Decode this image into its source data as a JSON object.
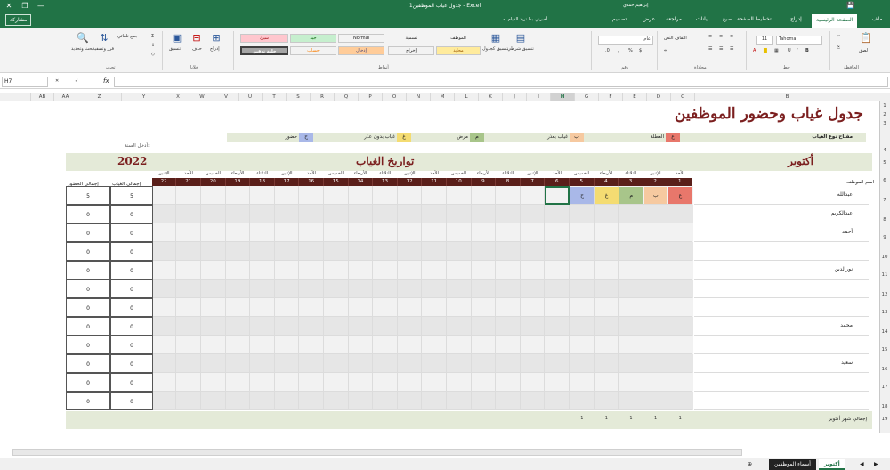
{
  "window": {
    "title": "جدول غياب الموظفين1 - Excel",
    "user": "إبراهيم حمدي",
    "minimize": "—",
    "maximize": "❐",
    "close": "✕",
    "save_icon": "save-icon"
  },
  "tabs": [
    {
      "label": "ملف"
    },
    {
      "label": "الصفحة الرئيسية",
      "active": true
    },
    {
      "label": "إدراج"
    },
    {
      "label": "تخطيط الصفحة"
    },
    {
      "label": "صيغ"
    },
    {
      "label": "بيانات"
    },
    {
      "label": "مراجعة"
    },
    {
      "label": "عرض"
    },
    {
      "label": "تصميم"
    }
  ],
  "tell_me": "أخبرني بما تريد القيام به",
  "share": "مشاركة",
  "ribbon": {
    "groups": [
      "الحافظة",
      "خط",
      "محاذاة",
      "رقم",
      "أنماط",
      "خلايا",
      "تحرير"
    ],
    "font_name": "Tahoma",
    "font_size": "11",
    "number_format": "عام",
    "styles": [
      {
        "label": "Normal",
        "bg": "#ffffff",
        "fg": "#000000"
      },
      {
        "label": "جيد",
        "bg": "#c6efce",
        "fg": "#006100"
      },
      {
        "label": "سيئ",
        "bg": "#ffc7ce",
        "fg": "#9c0006"
      },
      {
        "label": "محايد",
        "bg": "#ffeb9c",
        "fg": "#9c5700"
      },
      {
        "label": "إدخال",
        "bg": "#ffcc99",
        "fg": "#3f3f76"
      },
      {
        "label": "حساب",
        "bg": "#f2f2f2",
        "fg": "#fa7d00"
      },
      {
        "label": "خلية تدقيق",
        "bg": "#a5a5a5",
        "fg": "#ffffff"
      },
      {
        "label": "الموظف",
        "bg": "#ffffff",
        "fg": "#000000"
      },
      {
        "label": "تسمية",
        "bg": "#ffffff",
        "fg": "#000000"
      },
      {
        "label": "إخراج",
        "bg": "#f2f2f2",
        "fg": "#3f3f3f"
      }
    ],
    "buttons": {
      "paste": "لصق",
      "insert": "إدراج",
      "delete": "حذف",
      "format": "تنسيق",
      "sort": "فرز وتصفية",
      "find": "بحث وتحديد",
      "conditional": "تنسيق شرطي",
      "as_table": "تنسيق كجدول",
      "wrap": "التفاف النص",
      "autosum": "جمع تلقائي"
    }
  },
  "formula_bar": {
    "name_box": "H7",
    "fx": "fx",
    "value": ""
  },
  "columns": [
    "B",
    "C",
    "D",
    "E",
    "F",
    "G",
    "H",
    "I",
    "J",
    "K",
    "L",
    "M",
    "N",
    "O",
    "P",
    "Q",
    "R",
    "S",
    "T",
    "U",
    "V",
    "W",
    "X",
    "Y",
    "Z",
    "AA",
    "AB"
  ],
  "selected_column": "H",
  "rows": [
    "1",
    "2",
    "3",
    "4",
    "5",
    "6",
    "7",
    "8",
    "9",
    "10",
    "11",
    "12",
    "13",
    "14",
    "15",
    "16",
    "17",
    "18",
    "19"
  ],
  "sheet": {
    "title": "جدول غياب وحضور الموظفين",
    "legend_heading": "مفتاح نوع الغياب",
    "legend": [
      {
        "code": "ع",
        "label": "العطلة",
        "color": "#e8776b"
      },
      {
        "code": "ب",
        "label": "غياب بعذر",
        "color": "#f6c9a0"
      },
      {
        "code": "م",
        "label": "مرض",
        "color": "#a8c58a"
      },
      {
        "code": "غ",
        "label": "غياب بدون عذر",
        "color": "#f4dc72"
      },
      {
        "code": "ح",
        "label": "حضور",
        "color": "#a9b8e8"
      }
    ],
    "month": "أكتوبر",
    "dates_heading": "تواريخ الغياب",
    "year": "2022",
    "year_label": "أدخل السنة:",
    "employee_name_label": "اسم الموظف",
    "days": [
      "الأحد",
      "الإثنين",
      "الثلاثاء",
      "الأربعاء",
      "الخميس",
      "الأحد",
      "الإثنين",
      "الثلاثاء",
      "الأربعاء",
      "الخميس",
      "الأحد",
      "الإثنين",
      "الثلاثاء",
      "الأربعاء",
      "الخميس",
      "الأحد",
      "الإثنين",
      "الثلاثاء",
      "الأربعاء",
      "الخميس",
      "الأحد",
      "الإثنين"
    ],
    "day_numbers": [
      "1",
      "2",
      "3",
      "4",
      "5",
      "6",
      "7",
      "8",
      "9",
      "10",
      "11",
      "12",
      "13",
      "14",
      "15",
      "16",
      "17",
      "18",
      "19",
      "20",
      "21",
      "22"
    ],
    "total_absence_label": "إجمالي الغياب",
    "total_attendance_label": "إجمالي الحضور",
    "employees": [
      {
        "name": "عبدالله",
        "marks": [
          "ع",
          "ب",
          "م",
          "غ",
          "ح"
        ],
        "absence": "5",
        "attendance": "5"
      },
      {
        "name": "عبدالكريم",
        "marks": [],
        "absence": "0",
        "attendance": "0"
      },
      {
        "name": "أحمد",
        "marks": [],
        "absence": "0",
        "attendance": "0"
      },
      {
        "name": "",
        "marks": [],
        "absence": "0",
        "attendance": "0"
      },
      {
        "name": "نورالدين",
        "marks": [],
        "absence": "0",
        "attendance": "0"
      },
      {
        "name": "",
        "marks": [],
        "absence": "0",
        "attendance": "0"
      },
      {
        "name": "",
        "marks": [],
        "absence": "0",
        "attendance": "0"
      },
      {
        "name": "محمد",
        "marks": [],
        "absence": "0",
        "attendance": "0"
      },
      {
        "name": "",
        "marks": [],
        "absence": "0",
        "attendance": "0"
      },
      {
        "name": "سعيد",
        "marks": [],
        "absence": "0",
        "attendance": "0"
      },
      {
        "name": "",
        "marks": [],
        "absence": "0",
        "attendance": "0"
      },
      {
        "name": "",
        "marks": [],
        "absence": "0",
        "attendance": "0"
      }
    ],
    "month_total_label": "إجمالي شهر أكتوبر",
    "month_totals": [
      "1",
      "1",
      "1",
      "1",
      "1"
    ]
  },
  "sheet_tabs": [
    {
      "label": "أكتوبر",
      "active": true
    },
    {
      "label": "أسماء الموظفين",
      "dark": true
    }
  ],
  "add_sheet": "⊕"
}
